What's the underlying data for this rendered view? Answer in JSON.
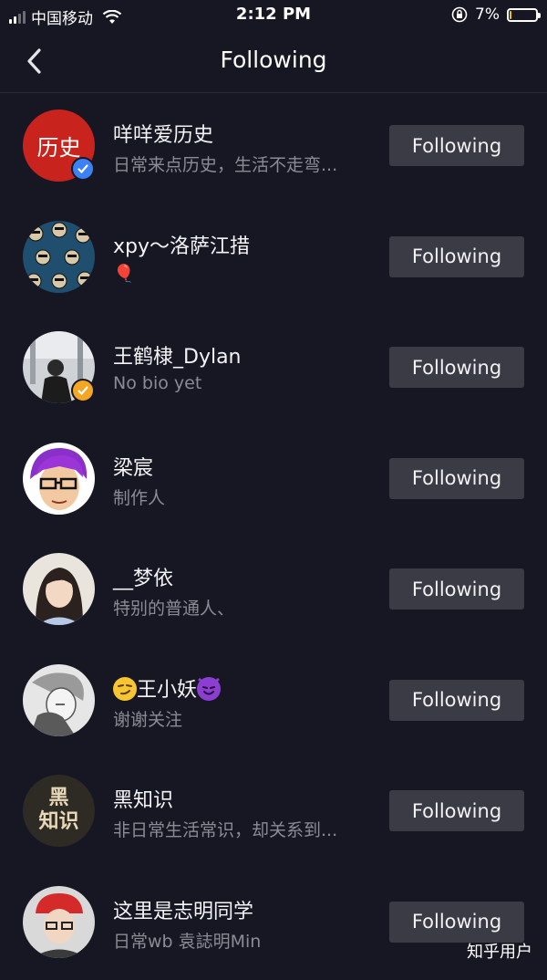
{
  "status_bar": {
    "carrier": "中国移动",
    "time": "2:12 PM",
    "battery_percent": "7%",
    "battery_level": 0.07
  },
  "nav": {
    "title": "Following"
  },
  "users": [
    {
      "name": "咩咩爱历史",
      "bio": "日常来点历史，生活不走弯...",
      "button": "Following",
      "avatar_text": "历史",
      "badge": "verified-blue"
    },
    {
      "name": "xpy～洛萨江措",
      "bio": "🎈",
      "button": "Following",
      "badge": ""
    },
    {
      "name": "王鹤棣_Dylan",
      "bio": "No bio yet",
      "button": "Following",
      "badge": "verified-orange"
    },
    {
      "name": "梁宸",
      "bio": "制作人",
      "button": "Following",
      "badge": ""
    },
    {
      "name": "__梦依",
      "bio": "特别的普通人、",
      "button": "Following",
      "badge": ""
    },
    {
      "name_prefix_emoji": "smirk",
      "name": "王小妖",
      "name_suffix_emoji": "devil",
      "bio": "谢谢关注",
      "button": "Following",
      "badge": ""
    },
    {
      "name": "黑知识",
      "bio": "非日常生活常识，却关系到...",
      "button": "Following",
      "avatar_text": "黑\n知识",
      "badge": ""
    },
    {
      "name": "这里是志明同学",
      "bio": "日常wb 袁誌明Min",
      "button": "Following",
      "badge": ""
    }
  ],
  "watermark": "知乎用户",
  "colors": {
    "background": "#161723",
    "button_bg": "#3a3b44",
    "badge_blue": "#3b82f6",
    "badge_orange": "#f5a623",
    "bio_text": "#8a8b93"
  }
}
